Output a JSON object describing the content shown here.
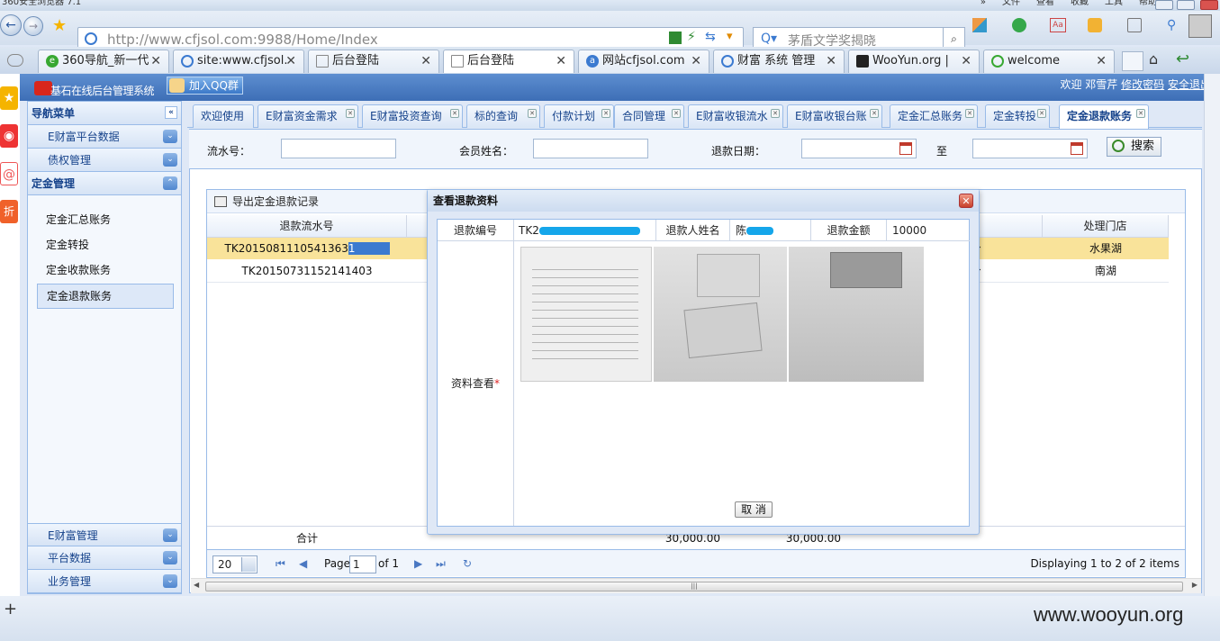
{
  "browser": {
    "window_title": "360安全浏览器 7.1",
    "menus": [
      "文件",
      "查看",
      "收藏",
      "工具",
      "帮助"
    ],
    "url_host": "http://www.cfjsol.com",
    "url_rest": ":9988/Home/Index",
    "search_text": "茅盾文学奖揭晓",
    "tabs": [
      {
        "label": "360导航_新一代",
        "icon": "360-icon",
        "color": "#38a832"
      },
      {
        "label": "site:www.cfjsol.",
        "icon": "search-icon",
        "color": "#3b7ad0"
      },
      {
        "label": "后台登陆",
        "icon": "page-icon",
        "color": "#888888"
      },
      {
        "label": "后台登陆",
        "icon": "page-icon",
        "color": "#888888"
      },
      {
        "label": "网站cfjsol.com",
        "icon": "baidu-icon",
        "color": "#3b7ad0"
      },
      {
        "label": "财富 系统 管理",
        "icon": "search-icon",
        "color": "#3b7ad0"
      },
      {
        "label": "WooYun.org |",
        "icon": "wooyun-icon",
        "color": "#222222"
      },
      {
        "label": "welcome",
        "icon": "ie-icon",
        "color": "#38a832"
      }
    ]
  },
  "app": {
    "title": "基石在线后台管理系统",
    "qq_button": "加入QQ群",
    "welcome": "欢迎 邓雪芹",
    "change_password": "修改密码",
    "logout": "安全退出"
  },
  "sidebar": {
    "header": "导航菜单",
    "sections_top": [
      "E财富平台数据",
      "债权管理"
    ],
    "current_section": "定金管理",
    "items": [
      "定金汇总账务",
      "定金转投",
      "定金收款账务",
      "定金退款账务"
    ],
    "sections_bottom": [
      "E财富管理",
      "平台数据",
      "业务管理"
    ]
  },
  "main_tabs": [
    "欢迎使用",
    "E财富资金需求",
    "E财富投资查询",
    "标的查询",
    "付款计划",
    "合同管理",
    "E财富收银流水",
    "E财富收银台账",
    "定金汇总账务",
    "定金转投",
    "定金退款账务"
  ],
  "filter": {
    "serial_label": "流水号：",
    "member_label": "会员姓名：",
    "date_label": "退款日期：",
    "to_label": "至",
    "search_button": "搜索"
  },
  "grid": {
    "export_label": "导出定金退款记录",
    "col_serial": "退款流水号",
    "col_store": "处理门店",
    "rows": [
      {
        "serial": "TK2015081110541363",
        "serial_cursor": "1",
        "time_tail": "4分",
        "store": "水果湖"
      },
      {
        "serial": "TK20150731152141403",
        "time_tail": "1分",
        "store": "南湖"
      }
    ],
    "total_label": "合计",
    "total_a": "30,000.00",
    "total_b": "30,000.00"
  },
  "pager": {
    "page_size": "20",
    "page_label": "Page",
    "page_value": "1",
    "of_label": "of 1",
    "displaying": "Displaying 1 to 2 of 2 items"
  },
  "modal": {
    "title": "查看退款资料",
    "refund_no_label": "退款编号",
    "refund_no_prefix": "TK2",
    "name_label": "退款人姓名",
    "name_prefix": "陈",
    "amount_label": "退款金额",
    "amount_value": "10000",
    "docs_label": "资料查看",
    "required_mark": "*",
    "cancel_button": "取 消"
  },
  "watermark": "www.wooyun.org"
}
